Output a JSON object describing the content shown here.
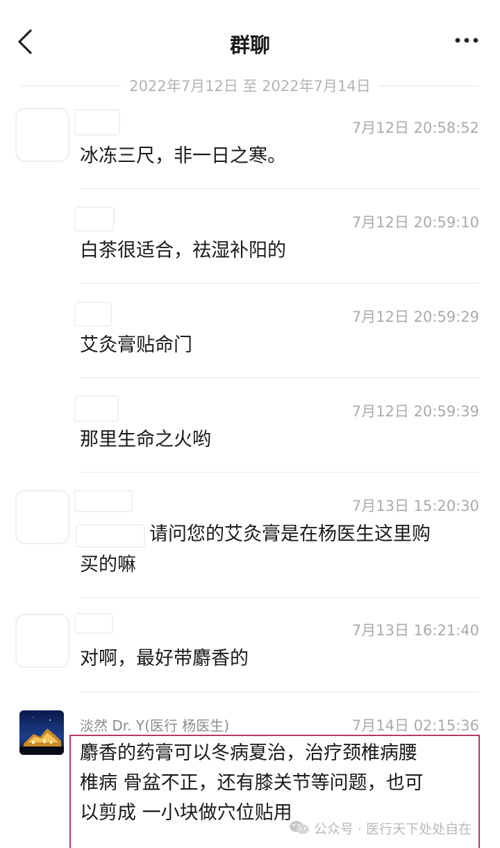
{
  "header": {
    "back_icon": "chevron-left-icon",
    "title": "群聊",
    "more_icon": "more-dots-icon"
  },
  "date_range": "2022年7月12日 至 2022年7月14日",
  "messages": [
    {
      "time": "7月12日 20:58:52",
      "text": "冰冻三尺，非一日之寒。"
    },
    {
      "time": "7月12日 20:59:10",
      "text": "白茶很适合，祛湿补阳的"
    },
    {
      "time": "7月12日 20:59:29",
      "text": "艾灸膏贴命门"
    },
    {
      "time": "7月12日 20:59:39",
      "text": "那里生命之火哟"
    },
    {
      "time": "7月13日 15:20:30",
      "text_line1": "请问您的艾灸膏是在杨医生这里购",
      "text_line2": "买的嘛"
    },
    {
      "time": "7月13日 16:21:40",
      "text": "对啊，最好带麝香的"
    },
    {
      "sender": "淡然 Dr. Y(医行 杨医生)",
      "time": "7月14日 02:15:36",
      "lines": [
        "麝香的药膏可以冬病夏治，治疗颈椎病腰",
        "椎病 骨盆不正，还有膝关节等问题，也可",
        "以剪成 一小块做穴位贴用"
      ]
    }
  ],
  "watermark": {
    "icon": "wechat-icon",
    "text": "公众号 · 医行天下处处自在"
  },
  "colors": {
    "highlight_border": "#b8385e",
    "timestamp": "#aaaaaa",
    "divider": "#e6e6e6"
  }
}
